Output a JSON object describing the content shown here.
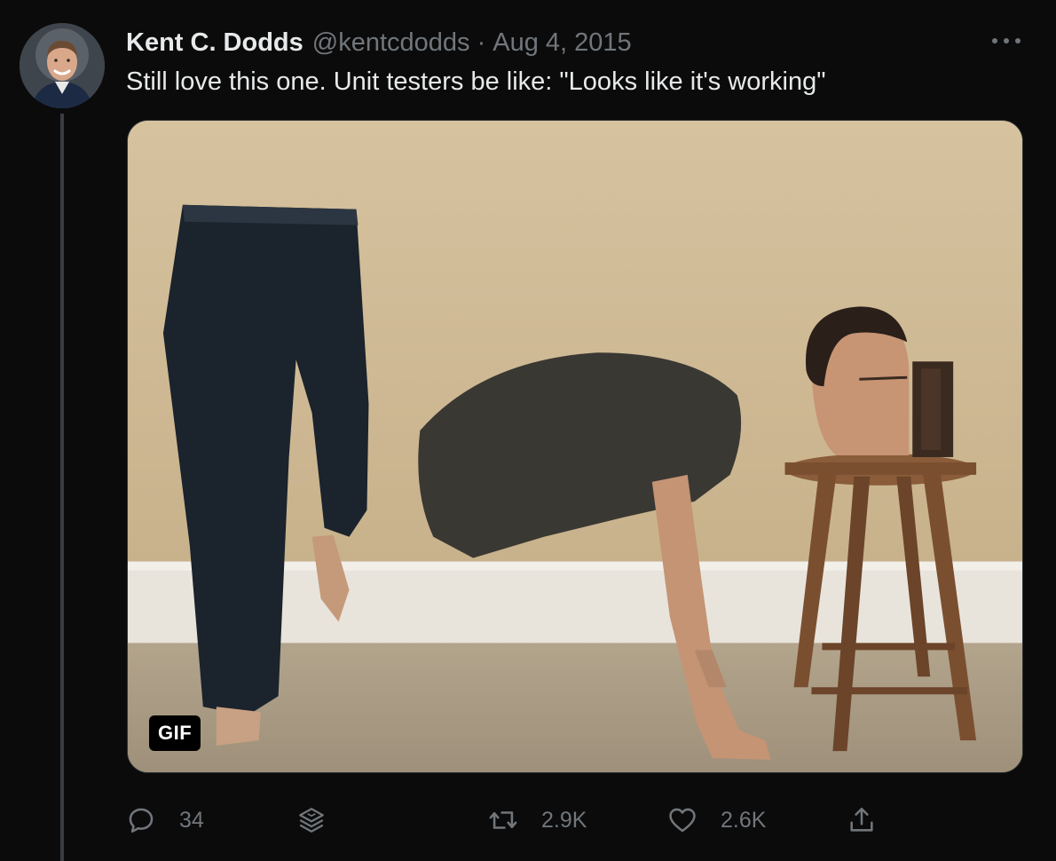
{
  "tweet": {
    "author_name": "Kent C. Dodds",
    "author_handle": "@kentcdodds",
    "separator": "·",
    "date": "Aug 4, 2015",
    "text": "Still love this one. Unit testers be like: \"Looks like it's working\"",
    "media_badge": "GIF"
  },
  "actions": {
    "reply_count": "34",
    "retweet_count": "2.9K",
    "like_count": "2.6K"
  },
  "icons": {
    "reply": "reply-icon",
    "thread": "stack-icon",
    "retweet": "retweet-icon",
    "like": "heart-icon",
    "share": "share-icon",
    "more": "more-icon"
  },
  "colors": {
    "background": "#0b0b0b",
    "text_primary": "#e7e9ea",
    "text_secondary": "#71767b",
    "wall": "#cdb892",
    "baseboard": "#e9e6df",
    "floor": "#a89a82"
  }
}
